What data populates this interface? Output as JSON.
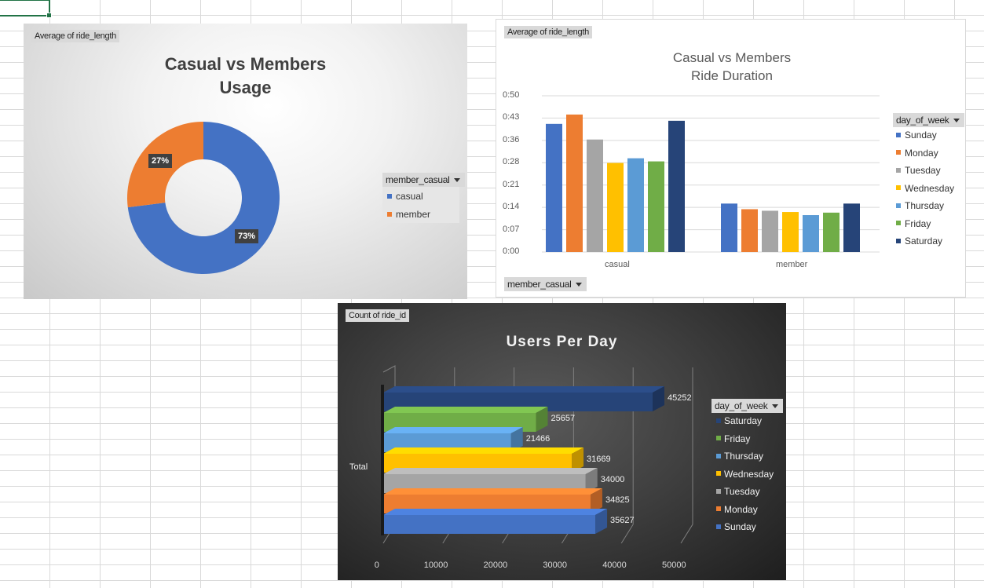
{
  "sheet": {
    "active_cell": "A1"
  },
  "chart1": {
    "field_tag": "Average of ride_length",
    "title_line1": "Casual vs Members",
    "title_line2": "Usage",
    "legend_field": "member_casual",
    "legend": [
      {
        "label": "casual",
        "color": "#4472c4"
      },
      {
        "label": "member",
        "color": "#ed7d31"
      }
    ],
    "chart_data": {
      "type": "pie",
      "subtype": "doughnut",
      "title": "Casual vs Members Usage",
      "categories": [
        "casual",
        "member"
      ],
      "values": [
        73,
        27
      ],
      "labels": [
        "73%",
        "27%"
      ],
      "colors": [
        "#4472c4",
        "#ed7d31"
      ],
      "legend_position": "right"
    }
  },
  "chart2": {
    "field_tag": "Average of ride_length",
    "title_line1": "Casual vs Members",
    "title_line2": "Ride Duration",
    "legend_field": "day_of_week",
    "axis_field": "member_casual",
    "yticks": [
      "0:00",
      "0:07",
      "0:14",
      "0:21",
      "0:28",
      "0:36",
      "0:43",
      "0:50"
    ],
    "chart_data": {
      "type": "bar",
      "title": "Casual vs Members Ride Duration",
      "categories": [
        "casual",
        "member"
      ],
      "ylim_minutes": [
        0,
        50
      ],
      "y_unit": "minutes",
      "grid": true,
      "legend_position": "right",
      "series": [
        {
          "name": "Sunday",
          "color": "#4472c4",
          "values": [
            41,
            15.5
          ]
        },
        {
          "name": "Monday",
          "color": "#ed7d31",
          "values": [
            44,
            13.7
          ]
        },
        {
          "name": "Tuesday",
          "color": "#a5a5a5",
          "values": [
            36,
            13.2
          ]
        },
        {
          "name": "Wednesday",
          "color": "#ffc000",
          "values": [
            28.5,
            12.8
          ]
        },
        {
          "name": "Thursday",
          "color": "#5b9bd5",
          "values": [
            30,
            11.8
          ]
        },
        {
          "name": "Friday",
          "color": "#70ad47",
          "values": [
            29,
            12.6
          ]
        },
        {
          "name": "Saturday",
          "color": "#264478",
          "values": [
            42,
            15.5
          ]
        }
      ]
    }
  },
  "chart3": {
    "field_tag": "Count of ride_id",
    "title": "Users Per Day",
    "legend_field": "day_of_week",
    "category_label": "Total",
    "chart_data": {
      "type": "bar",
      "orientation": "horizontal",
      "style": "3d",
      "title": "Users Per Day",
      "categories": [
        "Total"
      ],
      "xlim": [
        0,
        50000
      ],
      "xticks": [
        "0",
        "10000",
        "20000",
        "30000",
        "40000",
        "50000"
      ],
      "legend_position": "right",
      "series": [
        {
          "name": "Saturday",
          "color": "#264478",
          "value": 45252,
          "label": "45252"
        },
        {
          "name": "Friday",
          "color": "#70ad47",
          "value": 25657,
          "label": "25657"
        },
        {
          "name": "Thursday",
          "color": "#5b9bd5",
          "value": 21466,
          "label": "21466"
        },
        {
          "name": "Wednesday",
          "color": "#ffc000",
          "value": 31669,
          "label": "31669"
        },
        {
          "name": "Tuesday",
          "color": "#a5a5a5",
          "value": 34000,
          "label": "34000"
        },
        {
          "name": "Monday",
          "color": "#ed7d31",
          "value": 34825,
          "label": "34825"
        },
        {
          "name": "Sunday",
          "color": "#4472c4",
          "value": 35627,
          "label": "35627"
        }
      ]
    }
  }
}
